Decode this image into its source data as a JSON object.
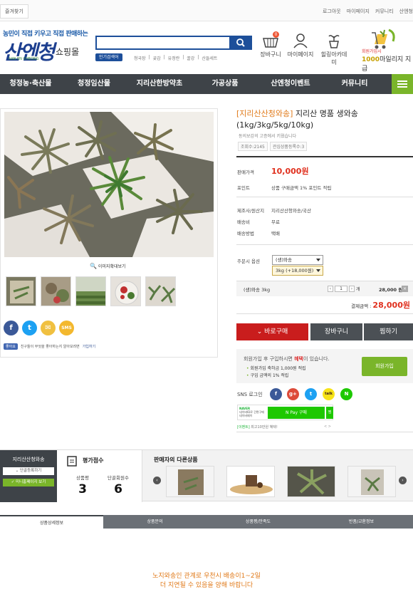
{
  "topbar": {
    "favorites": "즐겨찾기",
    "links": [
      "로그아웃",
      "마이페이지",
      "커뮤니티",
      "산엔청"
    ]
  },
  "header": {
    "tagline": "농민이 직접 키우고 직접 판매하는",
    "logo_main": "산엔청",
    "logo_sub": "쇼핑몰",
    "logo_en": "SAN EN CHEONG",
    "search": {
      "placeholder": "",
      "popular_label": "인기검색어",
      "popular": [
        "청국장",
        "곶감",
        "유정란",
        "꿀강",
        "산들세트"
      ]
    },
    "icons": [
      {
        "label": "장바구니",
        "badge": "0"
      },
      {
        "label": "마이페이지"
      },
      {
        "label": "힐링아카데미"
      }
    ],
    "mileage": {
      "line1": "회원가입시",
      "amount": "1000",
      "line2": "마일리지 지급"
    }
  },
  "nav": {
    "items": [
      "청정농·축산물",
      "청정임산물",
      "지리산한방약초",
      "가공상품",
      "산엔청이벤트",
      "커뮤니티"
    ]
  },
  "gallery": {
    "zoom_label": "이미지확대보기",
    "like_label": "좋아요",
    "like_text": "친구들이 무엇을 좋아하는지 알아보려면",
    "like_link": "가입하기"
  },
  "product": {
    "brand": "[지리산산청와송]",
    "title": "지리산 명품 생와송 (1kg/3kg/5kg/10kg)",
    "note": "동의보감의 고증에서 키웠습니다",
    "tags": [
      "조회수:2145",
      "관심상품등록수:3"
    ],
    "rows": [
      {
        "label": "판매가격",
        "value": "10,000원"
      },
      {
        "label": "포인트",
        "value": "상품 구매금액 1% 포인트 적립"
      },
      {
        "label": "제조사/원산지",
        "value": "지리산산청와송/국산"
      },
      {
        "label": "배송비",
        "value": "무료"
      },
      {
        "label": "배송방법",
        "value": "택배"
      }
    ],
    "option_label": "주문시 옵션",
    "option_select": "(생)와송",
    "option_sub": "3kg (+18,000원)",
    "selected": {
      "name": "(생)와송 3kg",
      "qty": "1",
      "qty_unit": "개",
      "price": "28,000 원"
    },
    "total_label": "결제금액 :",
    "total_value": "28,000원",
    "buttons": {
      "buy": "바로구매",
      "cart": "장바구니",
      "wish": "찜하기"
    }
  },
  "member": {
    "line1_pre": "회원가입 후 구입하시면 ",
    "line1_hi": "혜택",
    "line1_post": "이 있습니다.",
    "line2": "회원가입 축하금 1,000원 적립",
    "line3": "구입 금액의 1% 적립",
    "join": "회원가입"
  },
  "sns": {
    "label": "SNS 로그인",
    "items": [
      "f",
      "g+",
      "t",
      "talk",
      "N"
    ]
  },
  "npay": {
    "brand": "NAVER",
    "sub1": "네이버ID로 간편구매",
    "sub2": "네이버페이",
    "btn": "N Pay 구매",
    "wish": "찜",
    "event_tag": "[이벤트]",
    "event": "최고10만원 혜택!",
    "pager": "< >"
  },
  "seller": {
    "name": "지리산산청와송",
    "btn1": "단골등록하기",
    "btn2": "미니홈페이지 보기"
  },
  "rating": {
    "title": "평가점수",
    "labels": [
      "상품평",
      "단골회원수"
    ],
    "values": [
      "3",
      "6"
    ]
  },
  "others": {
    "title": "판매자의 다른상품"
  },
  "tabs": [
    "상품상세정보",
    "상품문의",
    "상품평/만족도",
    "반품/교환정보"
  ],
  "notice": {
    "line1": "노지와송인 관계로 우천시 배송이1~2일",
    "line2": "더 지연될 수 있음을 양해 바랍니다"
  },
  "colors": {
    "nav": "#3e4348",
    "accent_green": "#7ab52a",
    "price_red": "#e0301e",
    "brand_orange": "#e07a1a",
    "search_blue": "#1d4f9a"
  }
}
